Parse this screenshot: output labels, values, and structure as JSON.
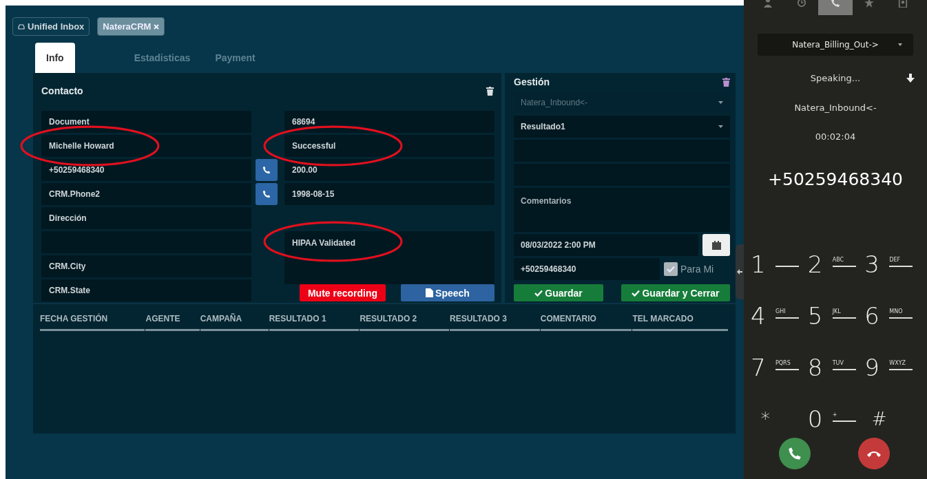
{
  "top_tabs": [
    {
      "label": "Unified Inbox",
      "kind": "inbox",
      "selected": false
    },
    {
      "label": "NateraCRM",
      "kind": "closable",
      "selected": true
    }
  ],
  "sub_tabs": [
    {
      "label": "Info",
      "selected": true
    },
    {
      "label": "Estadisticas",
      "selected": false
    },
    {
      "label": "Payment",
      "selected": false
    }
  ],
  "contact": {
    "title": "Contacto",
    "left_fields": [
      {
        "value": "Document",
        "circled": false,
        "call_button": false
      },
      {
        "value": "Michelle Howard",
        "circled": true,
        "call_button": false
      },
      {
        "value": "+50259468340",
        "circled": false,
        "call_button": true
      },
      {
        "value": "CRM.Phone2",
        "circled": false,
        "call_button": true
      },
      {
        "value": "Dirección",
        "circled": false,
        "call_button": false
      },
      {
        "circled": false,
        "call_button": false
      },
      {
        "value": "CRM.City",
        "circled": false,
        "call_button": false
      },
      {
        "value": "CRM.State",
        "circled": false,
        "call_button": false
      }
    ],
    "right_fields": [
      {
        "value": "68694",
        "kind": "input",
        "circled": false
      },
      {
        "value": "Successful",
        "kind": "input",
        "circled": true
      },
      {
        "value": "200.00",
        "kind": "input",
        "circled": false
      },
      {
        "value": "1998-08-15",
        "kind": "input",
        "circled": false
      },
      {
        "value": "HIPAA Validated",
        "kind": "textarea",
        "circled": true
      }
    ],
    "buttons": [
      {
        "label": "Mute recording",
        "kind": "danger"
      },
      {
        "label": "Speech",
        "kind": "speech"
      }
    ]
  },
  "gestion": {
    "title": "Gestión",
    "campaign": {
      "value": "Natera_Inbound<-",
      "disabled": true
    },
    "result": {
      "value": "Resultado1",
      "disabled": false
    },
    "comments": {
      "placeholder": "Comentarios"
    },
    "date": {
      "value": "08/03/2022 2:00 PM"
    },
    "phone": {
      "value": "+50259468340"
    },
    "para_mi": {
      "label": "Para Mi",
      "checked": true
    },
    "buttons": [
      {
        "label": "Guardar"
      },
      {
        "label": "Guardar y Cerrar"
      }
    ]
  },
  "history_table": {
    "columns": [
      "FECHA GESTIÓN",
      "AGENTE",
      "CAMPAÑA",
      "RESULTADO 1",
      "RESULTADO 2",
      "RESULTADO 3",
      "COMENTARIO",
      "TEL MARCADO"
    ]
  },
  "phone": {
    "top_icons": [
      {
        "kind": "person",
        "selected": false
      },
      {
        "kind": "clock",
        "selected": false
      },
      {
        "kind": "phone",
        "selected": true
      },
      {
        "kind": "star",
        "selected": false
      },
      {
        "kind": "contact",
        "selected": false
      }
    ],
    "campaign": "Natera_Billing_Out->",
    "status": "Speaking...",
    "queue": "Natera_Inbound<-",
    "timer": "00:02:04",
    "number": "+50259468340",
    "keys": [
      {
        "digit": "1"
      },
      {
        "digit": "2",
        "letters": "ABC"
      },
      {
        "digit": "3",
        "letters": "DEF"
      },
      {
        "digit": "4",
        "letters": "GHI"
      },
      {
        "digit": "5",
        "letters": "JKL"
      },
      {
        "digit": "6",
        "letters": "MNO"
      },
      {
        "digit": "7",
        "letters": "PQRS"
      },
      {
        "digit": "8",
        "letters": "TUV"
      },
      {
        "digit": "9",
        "letters": "WXYZ"
      },
      {
        "digit": "*",
        "kind": "symbol"
      },
      {
        "digit": "0",
        "letters": "+"
      },
      {
        "digit": "#",
        "kind": "symbol"
      }
    ]
  }
}
